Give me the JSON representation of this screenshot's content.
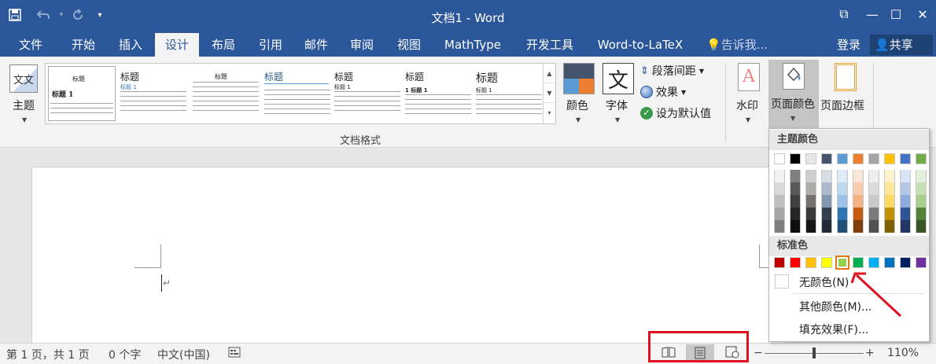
{
  "titlebar": {
    "title": "文档1 - Word",
    "save_icon": "save-icon",
    "undo_icon": "undo-icon",
    "redo_icon": "redo-icon",
    "customize_icon": "customize-caret-icon",
    "ribbon_display_glyph": "⧉",
    "minimize_glyph": "—",
    "maximize_glyph": "☐",
    "close_glyph": "✕"
  },
  "tabs": [
    {
      "label": "文件"
    },
    {
      "label": "开始"
    },
    {
      "label": "插入"
    },
    {
      "label": "设计",
      "active": true
    },
    {
      "label": "布局"
    },
    {
      "label": "引用"
    },
    {
      "label": "邮件"
    },
    {
      "label": "审阅"
    },
    {
      "label": "视图"
    },
    {
      "label": "MathType"
    },
    {
      "label": "开发工具"
    },
    {
      "label": "Word-to-LaTeX"
    }
  ],
  "tell_me": "告诉我...",
  "login": "登录",
  "share": "共享",
  "ribbon": {
    "theme_label": "主题",
    "theme_icon_text": "文文",
    "colors_label": "颜色",
    "fonts_label": "字体",
    "fonts_icon_text": "文",
    "paragraph_spacing": "段落间距",
    "effects": "效果",
    "set_default": "设为默认值",
    "group_label": "文档格式",
    "watermark_label": "水印",
    "watermark_icon_text": "A",
    "page_color_label": "页面颜色",
    "page_border_label": "页面边框",
    "styles": [
      {
        "heading": "标题",
        "sub": "标题 1"
      },
      {
        "heading": "标题",
        "sub": "标题 1"
      },
      {
        "heading": "标题",
        "sub": ""
      },
      {
        "heading": "标题",
        "sub": ""
      },
      {
        "heading": "标题",
        "sub": "标题 1"
      },
      {
        "heading": "标题",
        "sub": "1 标题 1"
      },
      {
        "heading": "标题",
        "sub": "标题 1"
      }
    ]
  },
  "document": {
    "paragraph_mark": "↵"
  },
  "status": {
    "page": "第 1 页，共 1 页",
    "words": "0 个字",
    "language": "中文(中国)",
    "zoom": "110%",
    "minus": "−",
    "plus": "+"
  },
  "dropdown": {
    "theme_colors_header": "主题颜色",
    "standard_colors_header": "标准色",
    "no_color": "无颜色(N)",
    "more_colors": "其他颜色(M)...",
    "fill_effects": "填充效果(F)...",
    "theme_top": [
      "#ffffff",
      "#000000",
      "#e7e6e6",
      "#44546a",
      "#5b9bd5",
      "#ed7d31",
      "#a5a5a5",
      "#ffc000",
      "#4472c4",
      "#70ad47"
    ],
    "theme_shades": [
      [
        "#f2f2f2",
        "#d9d9d9",
        "#bfbfbf",
        "#a6a6a6",
        "#7f7f7f"
      ],
      [
        "#7f7f7f",
        "#595959",
        "#404040",
        "#262626",
        "#0d0d0d"
      ],
      [
        "#d0cece",
        "#aeabab",
        "#757171",
        "#3a3838",
        "#171616"
      ],
      [
        "#d6dce4",
        "#adb9ca",
        "#8497b0",
        "#333f4f",
        "#222a35"
      ],
      [
        "#deebf6",
        "#bdd7ee",
        "#9dc3e6",
        "#2e75b5",
        "#1f4e79"
      ],
      [
        "#fbe5d5",
        "#f7cbac",
        "#f4b183",
        "#c55a11",
        "#833c0b"
      ],
      [
        "#ededed",
        "#dbdbdb",
        "#c9c9c9",
        "#7b7b7b",
        "#525252"
      ],
      [
        "#fff2cc",
        "#fee599",
        "#ffd965",
        "#bf9000",
        "#7f6000"
      ],
      [
        "#dae3f3",
        "#b4c7e7",
        "#8faadc",
        "#2f5496",
        "#1f3864"
      ],
      [
        "#e2efd9",
        "#c5e0b3",
        "#a8d08d",
        "#538135",
        "#375623"
      ]
    ],
    "standard": [
      "#c00000",
      "#ff0000",
      "#ffc000",
      "#ffff00",
      "#92d050",
      "#00b050",
      "#00b0f0",
      "#0070c0",
      "#002060",
      "#7030a0"
    ],
    "selected_standard_index": 4
  },
  "annotation": {
    "color": "#e0121f"
  }
}
